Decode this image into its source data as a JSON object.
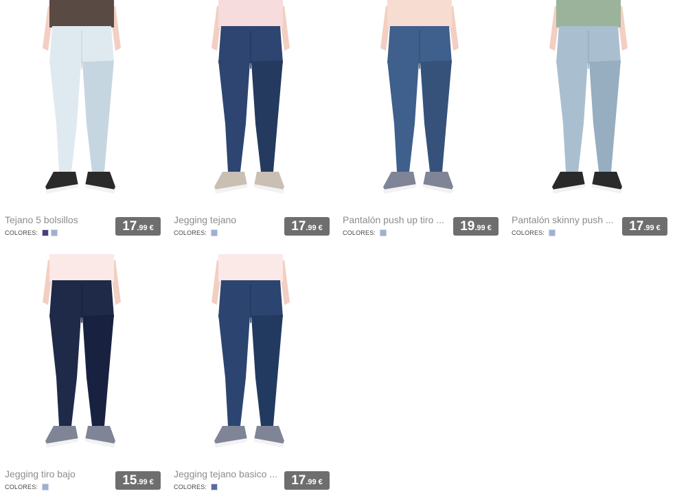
{
  "products": [
    {
      "name": "Tejano 5 bolsillos",
      "colors_label": "COLORES:",
      "swatches": [
        "#4b3f7a",
        "#9fb0cf"
      ],
      "price_int": "17",
      "price_dec": ".99",
      "currency": "€",
      "image": {
        "top": "#5a4a44",
        "jean": "#dfeaf0",
        "jean_shade": "#c6d6e0",
        "shoe": "#2a2a2a",
        "skin": "#f2cfc2"
      }
    },
    {
      "name": "Jegging tejano",
      "colors_label": "COLORES:",
      "swatches": [
        "#9fb0cf"
      ],
      "price_int": "17",
      "price_dec": ".99",
      "currency": "€",
      "image": {
        "top": "#f6dcdc",
        "jean": "#2d4570",
        "jean_shade": "#243a5f",
        "shoe": "#c9bfb3",
        "skin": "#f2cfc2"
      }
    },
    {
      "name": "Pantalón push up tiro ...",
      "colors_label": "COLORES:",
      "swatches": [
        "#9fb0cf"
      ],
      "price_int": "19",
      "price_dec": ".99",
      "currency": "€",
      "image": {
        "top": "#f7dcd2",
        "jean": "#3f5f8c",
        "jean_shade": "#36527a",
        "shoe": "#7f8596",
        "skin": "#f2cfc2"
      }
    },
    {
      "name": "Pantalón skinny push ...",
      "colors_label": "COLORES:",
      "swatches": [
        "#9fb0cf"
      ],
      "price_int": "17",
      "price_dec": ".99",
      "currency": "€",
      "image": {
        "top": "#9bb39a",
        "jean": "#a9bfd0",
        "jean_shade": "#97adc0",
        "shoe": "#2a2a2a",
        "skin": "#f2cfc2"
      }
    },
    {
      "name": "Jegging tiro bajo",
      "colors_label": "COLORES:",
      "swatches": [
        "#9fb0cf"
      ],
      "price_int": "15",
      "price_dec": ".99",
      "currency": "€",
      "image": {
        "top": "#fbe9e7",
        "jean": "#1e2a48",
        "jean_shade": "#182240",
        "shoe": "#7f8596",
        "skin": "#f2cfc2"
      }
    },
    {
      "name": "Jegging tejano basico ...",
      "colors_label": "COLORES:",
      "swatches": [
        "#5e6aa6"
      ],
      "price_int": "17",
      "price_dec": ".99",
      "currency": "€",
      "image": {
        "top": "#fbe9e7",
        "jean": "#2c4570",
        "jean_shade": "#233a60",
        "shoe": "#7f8596",
        "skin": "#f2cfc2"
      }
    }
  ]
}
